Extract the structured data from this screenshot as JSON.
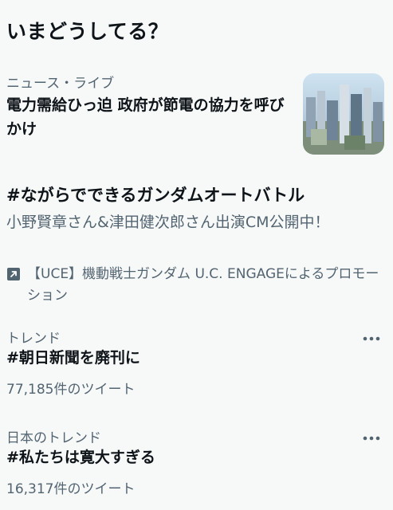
{
  "panel": {
    "title": "いまどうしてる？"
  },
  "news": {
    "category": "ニュース・ライブ",
    "headline": "電力需給ひっ迫 政府が節電の協力を呼びかけ"
  },
  "promoted": {
    "headline": "#ながらでできるガンダムオートバトル",
    "description": "小野賢章さん&津田健次郎さん出演CM公開中！",
    "promoted_by": "【UCE】機動戦士ガンダム U.C. ENGAGEによるプロモーション",
    "icon": "promoted-arrow-icon"
  },
  "trends": [
    {
      "context": "トレンド",
      "name": "#朝日新聞を廃刊に",
      "count": "77,185件のツイート"
    },
    {
      "context": "日本のトレンド",
      "name": "#私たちは寛大すぎる",
      "count": "16,317件のツイート"
    }
  ],
  "colors": {
    "primary_text": "#0f1419",
    "secondary_text": "#536471",
    "background": "#f7f9f9"
  }
}
